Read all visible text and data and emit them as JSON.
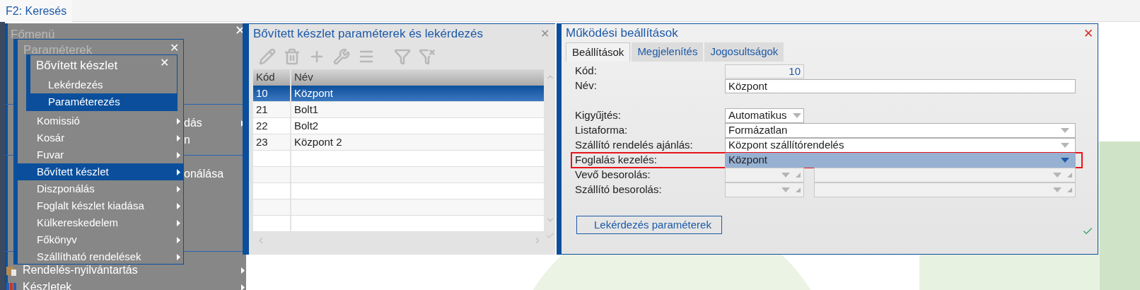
{
  "top_bar": {
    "search_tab": "F2: Keresés"
  },
  "main_menu": {
    "title": "Főmenü",
    "close": "✕",
    "items": [
      {
        "label": "dás",
        "arrow": true,
        "kind": "plain"
      },
      {
        "label": "n",
        "arrow": false,
        "kind": "plain"
      },
      {
        "label": "onálása",
        "arrow": false,
        "kind": "plain"
      },
      {
        "label": "Rendelés-nyilvántartás",
        "arrow": true,
        "kind": "box"
      },
      {
        "label": "Készletek",
        "arrow": true,
        "kind": "books"
      }
    ]
  },
  "params_menu": {
    "title": "Paraméterek",
    "close": "✕",
    "items": [
      {
        "label": "Komissió",
        "selected": false
      },
      {
        "label": "Kosár",
        "selected": false
      },
      {
        "label": "Fuvar",
        "selected": false
      },
      {
        "label": "Bővített készlet",
        "selected": true
      },
      {
        "label": "Diszponálás",
        "selected": false
      },
      {
        "label": "Foglalt készlet kiadása",
        "selected": false
      },
      {
        "label": "Külkereskedelem",
        "selected": false
      },
      {
        "label": "Főkönyv",
        "selected": false
      },
      {
        "label": "Szállítható rendelések",
        "selected": false
      }
    ]
  },
  "stock_menu": {
    "title": "Bővített készlet",
    "close": "✕",
    "items": [
      {
        "label": "Lekérdezés",
        "selected": false
      },
      {
        "label": "Paraméterezés",
        "selected": true
      }
    ]
  },
  "list_window": {
    "title": "Bővített készlet paraméterek és lekérdezés",
    "close": "✕",
    "toolbar": [
      {
        "kind": "edit"
      },
      {
        "kind": "delete"
      },
      {
        "kind": "add"
      },
      {
        "kind": "tools"
      },
      {
        "kind": "list"
      },
      {
        "kind": "filter"
      },
      {
        "kind": "filter-clear"
      }
    ],
    "table": {
      "columns": [
        "Kód",
        "Név"
      ],
      "rows": [
        {
          "cells": [
            "10",
            "Központ"
          ],
          "selected": true
        },
        {
          "cells": [
            "21",
            "Bolt1"
          ],
          "selected": false
        },
        {
          "cells": [
            "22",
            "Bolt2"
          ],
          "selected": false
        },
        {
          "cells": [
            "23",
            "Központ 2"
          ],
          "selected": false
        }
      ]
    }
  },
  "settings_window": {
    "title": "Működési beállítások",
    "close": "✕",
    "tabs": [
      {
        "label": "Beállítások",
        "selected": true
      },
      {
        "label": "Megjelenítés",
        "selected": false
      },
      {
        "label": "Jogosultságok",
        "selected": false
      }
    ],
    "fields": [
      {
        "label": "Kód:",
        "kind": "number",
        "value": "10",
        "selected": false
      },
      {
        "label": "Név:",
        "kind": "text",
        "value": "Központ",
        "selected": false
      },
      {
        "kind": "gap"
      },
      {
        "label": "Kigyűjtés:",
        "kind": "short-dropdown",
        "value": "Automatikus",
        "selected": false
      },
      {
        "label": "Listaforma:",
        "kind": "dropdown",
        "value": "Formázatlan",
        "selected": false
      },
      {
        "label": "Szállító rendelés ajánlás:",
        "kind": "dropdown",
        "value": "Központ szállítórendelés",
        "selected": false
      },
      {
        "label": "Foglalás kezelés:",
        "kind": "dropdown",
        "value": "Központ",
        "selected": true
      },
      {
        "label": "Vevő besorolás:",
        "kind": "pair",
        "selected": false
      },
      {
        "label": "Szállító besorolás:",
        "kind": "pair",
        "selected": false
      }
    ],
    "button": "Lekérdezés paraméterek"
  }
}
